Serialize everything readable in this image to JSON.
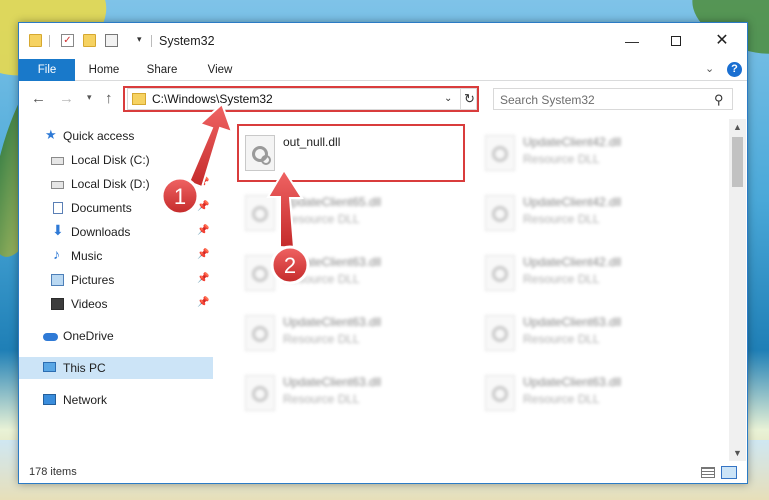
{
  "window": {
    "title": "System32",
    "controls": {
      "minimize": "—",
      "maximize": "",
      "close": "✕"
    }
  },
  "ribbon": {
    "tabs": [
      "File",
      "Home",
      "Share",
      "View"
    ],
    "help": "?"
  },
  "nav": {
    "address": "C:\\Windows\\System32",
    "search_placeholder": "Search System32"
  },
  "sidebar": {
    "items": [
      {
        "label": "Quick access",
        "icon": "star-icon",
        "pinned": false
      },
      {
        "label": "Local Disk (C:)",
        "icon": "drive-icon",
        "pinned": true
      },
      {
        "label": "Local Disk (D:)",
        "icon": "drive-icon",
        "pinned": true
      },
      {
        "label": "Documents",
        "icon": "documents-icon",
        "pinned": true
      },
      {
        "label": "Downloads",
        "icon": "download-icon",
        "pinned": true
      },
      {
        "label": "Music",
        "icon": "music-icon",
        "pinned": true
      },
      {
        "label": "Pictures",
        "icon": "pictures-icon",
        "pinned": true
      },
      {
        "label": "Videos",
        "icon": "videos-icon",
        "pinned": true
      },
      {
        "label": "OneDrive",
        "icon": "onedrive-icon",
        "pinned": false
      },
      {
        "label": "This PC",
        "icon": "this-pc-icon",
        "pinned": false,
        "selected": true
      },
      {
        "label": "Network",
        "icon": "network-icon",
        "pinned": false
      }
    ]
  },
  "files": [
    {
      "name": "out_null.dll",
      "type": "",
      "highlighted": true
    },
    {
      "name": "UpdateClient42.dll",
      "type": "Resource DLL"
    },
    {
      "name": "UpdateClient65.dll",
      "type": "Resource DLL"
    },
    {
      "name": "UpdateClient42.dll",
      "type": "Resource DLL"
    },
    {
      "name": "UpdateClient63.dll",
      "type": "Resource DLL"
    },
    {
      "name": "UpdateClient42.dll",
      "type": "Resource DLL"
    },
    {
      "name": "UpdateClient63.dll",
      "type": "Resource DLL"
    },
    {
      "name": "UpdateClient63.dll",
      "type": "Resource DLL"
    },
    {
      "name": "UpdateClient63.dll",
      "type": "Resource DLL"
    },
    {
      "name": "UpdateClient63.dll",
      "type": "Resource DLL"
    }
  ],
  "status": {
    "items": "178 items"
  },
  "callouts": {
    "step1": "1",
    "step2": "2"
  },
  "colors": {
    "accent": "#1979ca",
    "highlight": "#d93c3c",
    "selected": "#cce4f7"
  }
}
